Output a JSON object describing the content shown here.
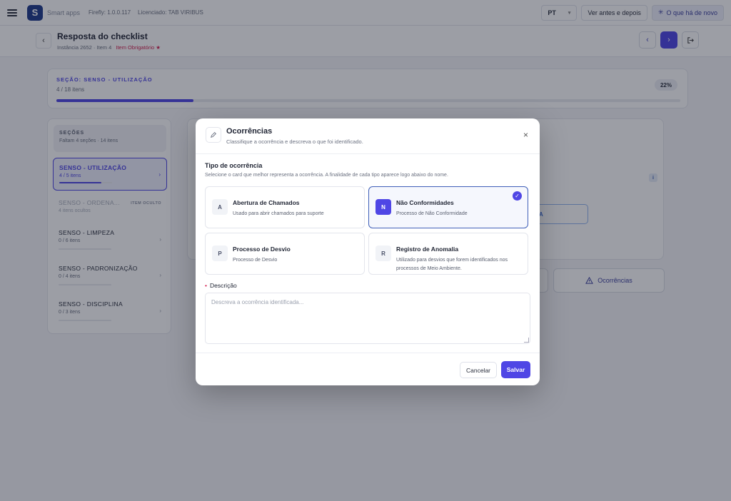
{
  "topbar": {
    "brand": "Smart apps",
    "version": "Firefly: 1.0.0.117",
    "license": "Licenciado: TAB VIRIBUS",
    "language": "PT",
    "before_after": "Ver antes e depois",
    "whats_new": "O que há de novo"
  },
  "header": {
    "title": "Resposta do checklist",
    "subtitle": "Instância 2652 · Item 4",
    "required": "Item Obrigatório ★"
  },
  "progress": {
    "section_label": "SEÇÃO: SENSO - UTILIZAÇÃO",
    "count": "4 / 18 itens",
    "percent_label": "22%",
    "percent": 22
  },
  "sidebar": {
    "title": "SEÇÕES",
    "subtitle": "Faltam 4 seções · 14 itens",
    "items": [
      {
        "name": "SENSO - UTILIZAÇÃO",
        "count": "4 / 5 itens",
        "progress": 80
      },
      {
        "name": "SENSO - ORDENA...",
        "count": "4 itens ocultos",
        "tag": "ITEM OCULTO"
      },
      {
        "name": "SENSO - LIMPEZA",
        "count": "0 / 6 itens",
        "progress": 0
      },
      {
        "name": "SENSO - PADRONIZAÇÃO",
        "count": "0 / 4 itens",
        "progress": 0
      },
      {
        "name": "SENSO - DISCIPLINA",
        "count": "0 / 3 itens",
        "progress": 0
      }
    ]
  },
  "background": {
    "info": "i",
    "outline_btn": "A",
    "occurrences_btn": "Ocorrências"
  },
  "modal": {
    "title": "Ocorrências",
    "subtitle": "Classifique a ocorrência e descreva o que foi identificado.",
    "type_title": "Tipo de ocorrência",
    "type_desc": "Selecione o card que melhor representa a ocorrência. A finalidade de cada tipo aparece logo abaixo do nome.",
    "options": [
      {
        "letter": "A",
        "title": "Abertura de Chamados",
        "desc": "Usado para abrir chamados para suporte"
      },
      {
        "letter": "N",
        "title": "Não Conformidades",
        "desc": "Processo de Não Conformidade"
      },
      {
        "letter": "P",
        "title": "Processo de Desvio",
        "desc": "Processo de Desvio"
      },
      {
        "letter": "R",
        "title": "Registro de Anomalia",
        "desc": "Utilizado para desvios que forem identificados nos processos de Meio Ambiente."
      }
    ],
    "description_label": "Descrição",
    "description_placeholder": "Descreva a ocorrência identificada...",
    "cancel": "Cancelar",
    "save": "Salvar"
  },
  "colors": {
    "accent": "#4f46e5",
    "required": "#d32050"
  }
}
